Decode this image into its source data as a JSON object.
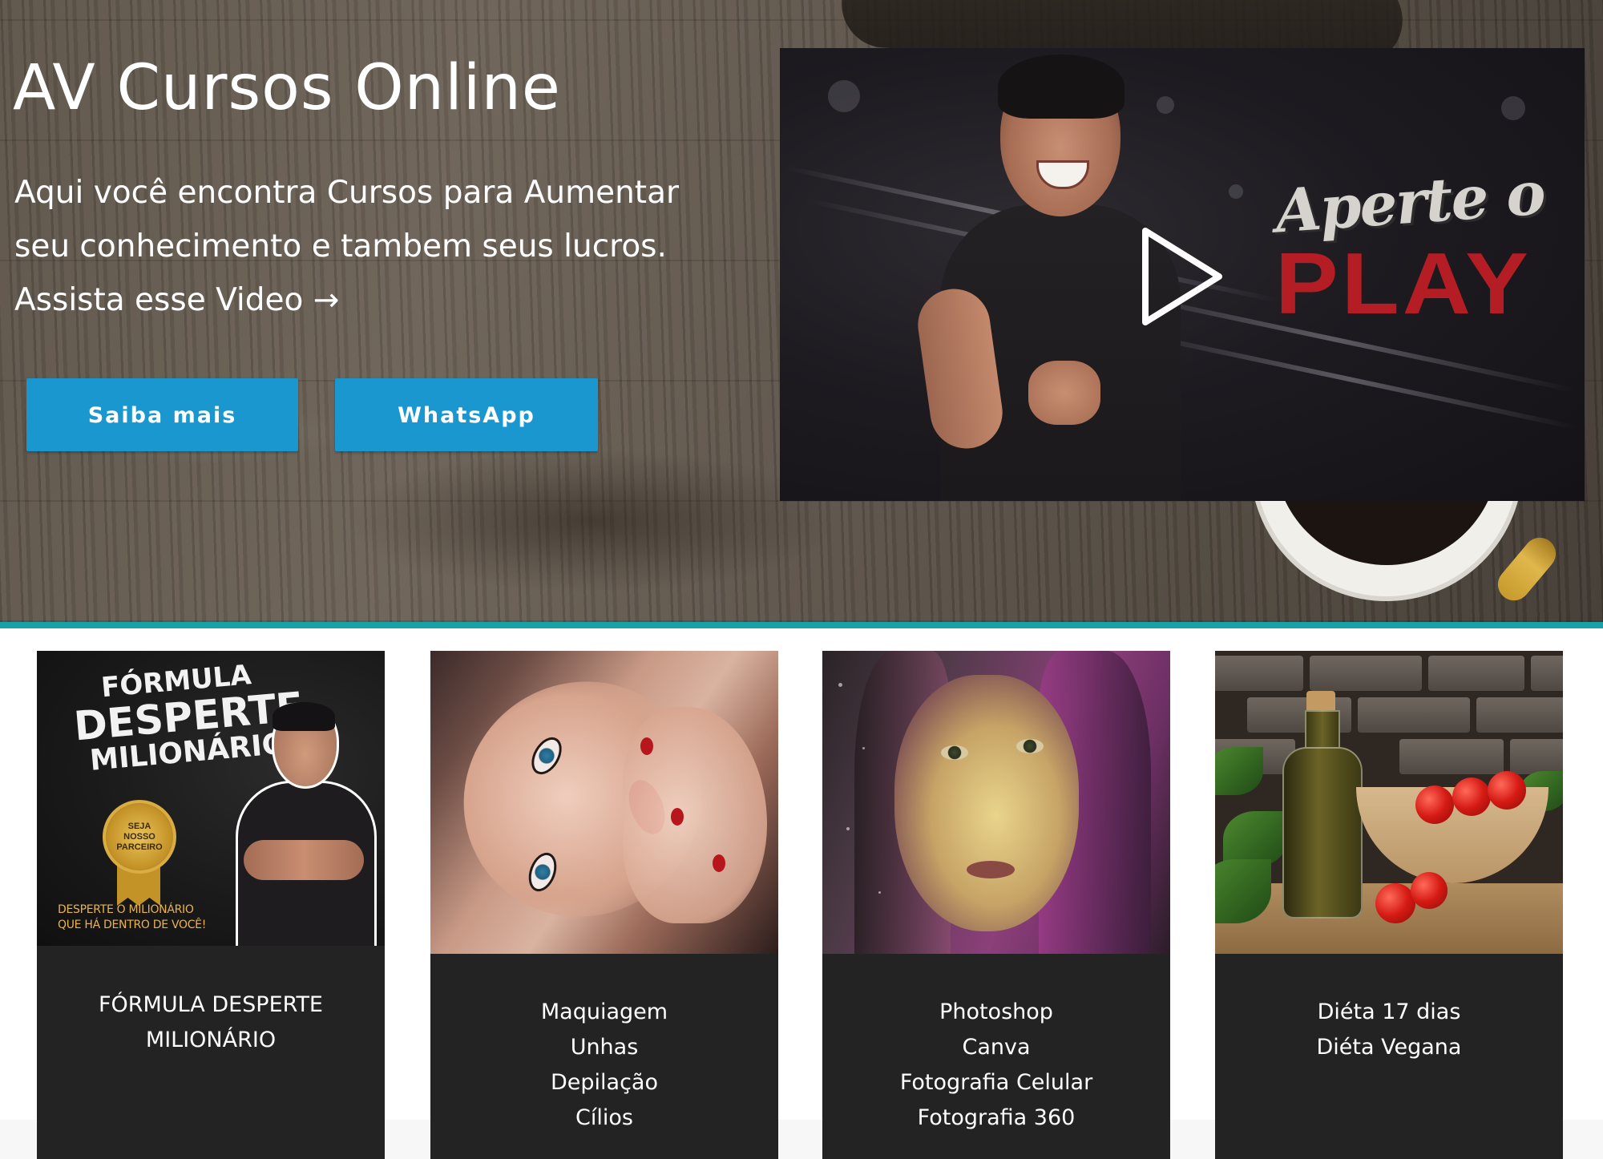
{
  "hero": {
    "title": "AV Cursos Online",
    "text_lines": [
      "Aqui você encontra Cursos para Aumentar",
      "seu conhecimento e tambem seus lucros.",
      "Assista esse Video →"
    ],
    "buttons": {
      "saiba_mais": "Saiba mais",
      "whatsapp": "WhatsApp"
    },
    "button_color": "#1a97cf"
  },
  "video": {
    "overlay_script": "Aperte o",
    "overlay_word": "PLAY",
    "icon": "play-icon",
    "accent_color": "#b51d25"
  },
  "divider_color": "#17a2a8",
  "courses": [
    {
      "image_title_lines": [
        "FÓRMULA",
        "DESPERTE",
        "MILIONÁRIO"
      ],
      "image_seal_lines": [
        "SEJA",
        "NOSSO",
        "PARCEIRO"
      ],
      "image_tagline_lines": [
        "DESPERTE O MILIONÁRIO",
        "QUE HÁ DENTRO DE VOCÊ!"
      ],
      "lines": [
        "FÓRMULA DESPERTE",
        "MILIONÁRIO"
      ]
    },
    {
      "lines": [
        "Maquiagem",
        "Unhas",
        "Depilação",
        "Cílios"
      ]
    },
    {
      "lines": [
        "Photoshop",
        "Canva",
        "Fotografia Celular",
        "Fotografia 360"
      ]
    },
    {
      "lines": [
        "Diéta 17 dias",
        "Diéta Vegana"
      ]
    }
  ]
}
